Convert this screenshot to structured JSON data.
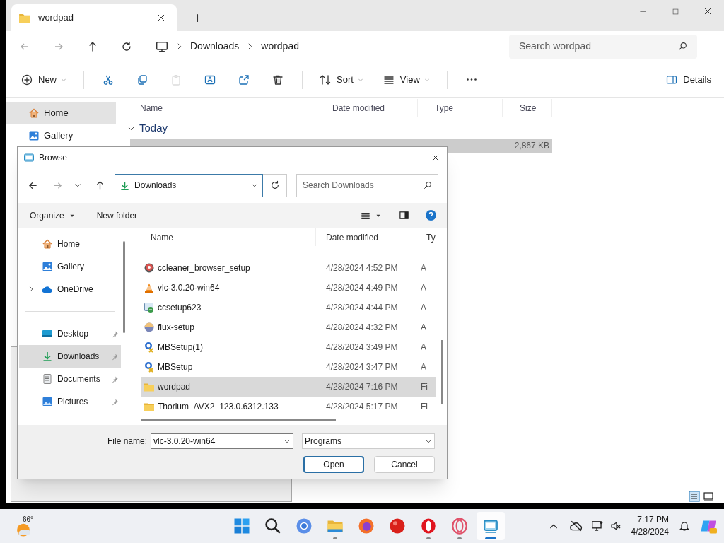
{
  "explorer": {
    "tab": {
      "title": "wordpad"
    },
    "breadcrumb": [
      "Downloads",
      "wordpad"
    ],
    "search": {
      "placeholder": "Search wordpad"
    },
    "commands": [
      {
        "kind": "new",
        "label": "New",
        "disabled": false
      },
      {
        "kind": "cut",
        "disabled": false
      },
      {
        "kind": "copy",
        "disabled": false
      },
      {
        "kind": "paste",
        "disabled": true
      },
      {
        "kind": "rename",
        "disabled": false
      },
      {
        "kind": "share",
        "disabled": false
      },
      {
        "kind": "delete",
        "disabled": false
      },
      {
        "kind": "sort",
        "label": "Sort",
        "disabled": false
      },
      {
        "kind": "view",
        "label": "View",
        "disabled": false
      },
      {
        "kind": "more",
        "disabled": false
      }
    ],
    "details": "Details",
    "sidebar": [
      {
        "label": "Home",
        "kind": "home",
        "selected": true
      },
      {
        "label": "Gallery",
        "kind": "gallery",
        "selected": false
      }
    ],
    "columns": [
      "Name",
      "Date modified",
      "Type",
      "Size"
    ],
    "group": {
      "label": "Today",
      "expanded": true
    },
    "row": {
      "size": "2,867 KB",
      "selected": true
    }
  },
  "dialog": {
    "title": "Browse",
    "address": "Downloads",
    "search": {
      "placeholder": "Search Downloads"
    },
    "organize": "Organize",
    "new_folder": "New folder",
    "nav": [
      {
        "label": "Home",
        "kind": "home",
        "selected": false,
        "pinned": false,
        "expandable": false
      },
      {
        "label": "Gallery",
        "kind": "gallery",
        "selected": false,
        "pinned": false,
        "expandable": false
      },
      {
        "label": "OneDrive",
        "kind": "cloud",
        "selected": false,
        "pinned": false,
        "expandable": true
      },
      {
        "label": "Desktop",
        "kind": "desktop",
        "selected": false,
        "pinned": true,
        "expandable": false
      },
      {
        "label": "Downloads",
        "kind": "download",
        "selected": true,
        "pinned": true,
        "expandable": false
      },
      {
        "label": "Documents",
        "kind": "document",
        "selected": false,
        "pinned": true,
        "expandable": false
      },
      {
        "label": "Pictures",
        "kind": "pictures",
        "selected": false,
        "pinned": true,
        "expandable": false
      }
    ],
    "columns": [
      "Name",
      "Date modified",
      "Ty"
    ],
    "files": [
      {
        "name": "ccleaner_browser_setup",
        "date": "4/28/2024 4:52 PM",
        "type": "A",
        "kind": "disc",
        "selected": false
      },
      {
        "name": "vlc-3.0.20-win64",
        "date": "4/28/2024 4:49 PM",
        "type": "A",
        "kind": "cone",
        "selected": false
      },
      {
        "name": "ccsetup623",
        "date": "4/28/2024 4:44 PM",
        "type": "A",
        "kind": "setup",
        "selected": false
      },
      {
        "name": "flux-setup",
        "date": "4/28/2024 4:32 PM",
        "type": "A",
        "kind": "sphere",
        "selected": false
      },
      {
        "name": "MBSetup(1)",
        "date": "4/28/2024 3:49 PM",
        "type": "A",
        "kind": "mb",
        "selected": false
      },
      {
        "name": "MBSetup",
        "date": "4/28/2024 3:47 PM",
        "type": "A",
        "kind": "mb",
        "selected": false
      },
      {
        "name": "wordpad",
        "date": "4/28/2024 7:16 PM",
        "type": "Fi",
        "kind": "folder",
        "selected": true
      },
      {
        "name": "Thorium_AVX2_123.0.6312.133",
        "date": "4/28/2024 5:17 PM",
        "type": "Fi",
        "kind": "folder",
        "selected": false
      }
    ],
    "file_name_label": "File name:",
    "file_name": "vlc-3.0.20-win64",
    "filter": "Programs",
    "buttons": [
      {
        "label": "Open",
        "kind": "default"
      },
      {
        "label": "Cancel",
        "kind": "normal"
      }
    ]
  },
  "taskbar": {
    "weather": "66°",
    "apps": [
      {
        "kind": "windows",
        "running": false,
        "active": false
      },
      {
        "kind": "search",
        "running": false,
        "active": false
      },
      {
        "kind": "chrome",
        "running": false,
        "active": false
      },
      {
        "kind": "explorer",
        "running": true,
        "active": false
      },
      {
        "kind": "firefox",
        "running": false,
        "active": false
      },
      {
        "kind": "redball",
        "running": false,
        "active": false
      },
      {
        "kind": "opera",
        "running": true,
        "active": false
      },
      {
        "kind": "operagx",
        "running": true,
        "active": false
      },
      {
        "kind": "app",
        "running": true,
        "active": true
      }
    ],
    "time": "7:17 PM",
    "date": "4/28/2024"
  }
}
